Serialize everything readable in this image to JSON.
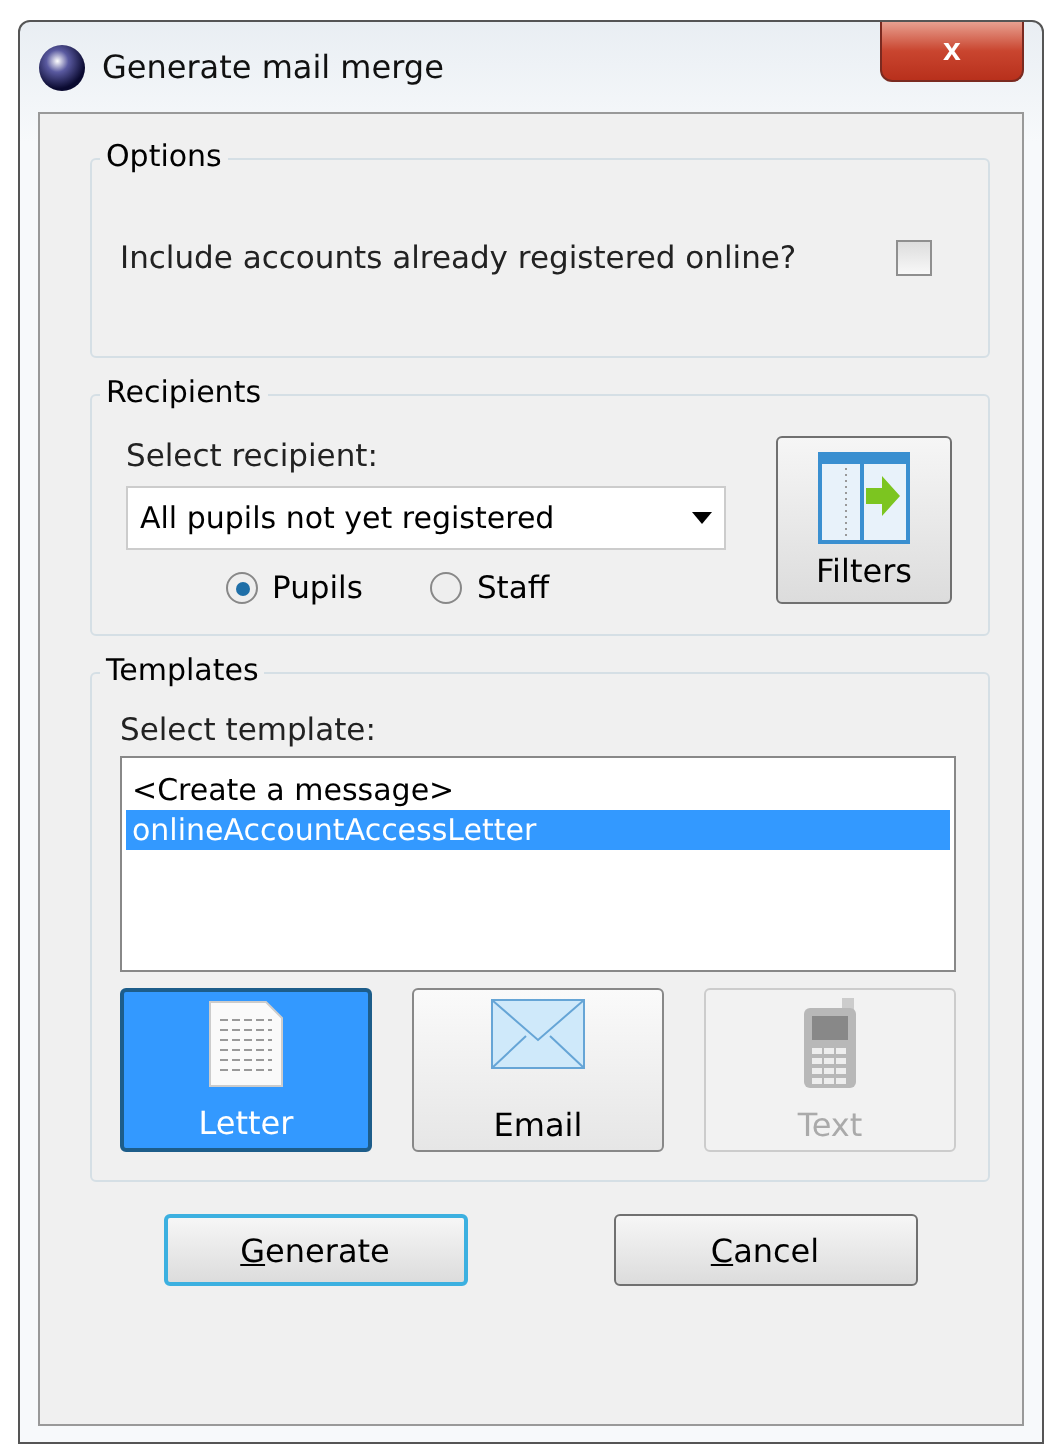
{
  "window": {
    "title": "Generate mail merge",
    "close": "x"
  },
  "options": {
    "title": "Options",
    "include_registered": {
      "label": "Include accounts already registered online?",
      "checked": false
    }
  },
  "recipients": {
    "title": "Recipients",
    "select_label": "Select recipient:",
    "select_value": "All pupils not yet registered",
    "filters_button": "Filters",
    "radios": [
      {
        "label": "Pupils",
        "selected": true
      },
      {
        "label": "Staff",
        "selected": false
      }
    ]
  },
  "templates": {
    "title": "Templates",
    "select_label": "Select template:",
    "items": [
      {
        "label": "<Create a message>",
        "selected": false
      },
      {
        "label": "onlineAccountAccessLetter",
        "selected": true
      }
    ],
    "types": [
      {
        "kind": "letter",
        "label": "Letter",
        "selected": true,
        "disabled": false
      },
      {
        "kind": "email",
        "label": "Email",
        "selected": false,
        "disabled": false
      },
      {
        "kind": "text",
        "label": "Text",
        "selected": false,
        "disabled": true
      }
    ]
  },
  "buttons": [
    {
      "label": "Generate",
      "underline_first": true,
      "default": true
    },
    {
      "label": "Cancel",
      "underline_first": true,
      "default": false
    }
  ]
}
